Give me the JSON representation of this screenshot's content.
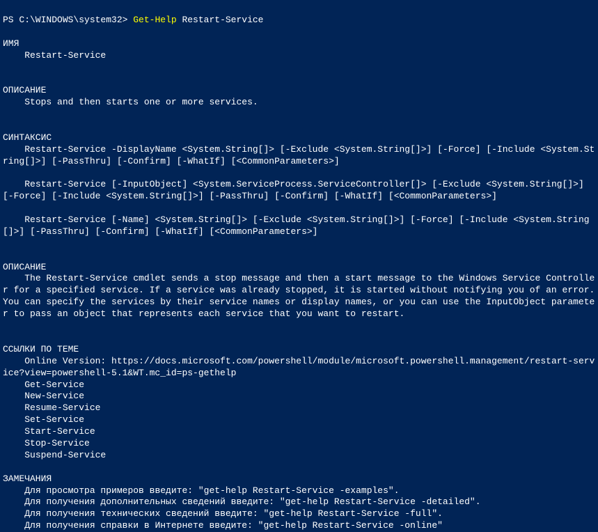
{
  "prompt": {
    "prefix": "PS C:\\WINDOWS\\system32> ",
    "command": "Get-Help",
    "argument": " Restart-Service"
  },
  "sections": {
    "name": {
      "header": "ИМЯ",
      "content": "Restart-Service"
    },
    "description1": {
      "header": "ОПИСАНИЕ",
      "content": "Stops and then starts one or more services."
    },
    "syntax": {
      "header": "СИНТАКСИС",
      "line1": "Restart-Service -DisplayName <System.String[]> [-Exclude <System.String[]>] [-Force] [-Include <System.String[]>] [-PassThru] [-Confirm] [-WhatIf] [<CommonParameters>]",
      "line2": "Restart-Service [-InputObject] <System.ServiceProcess.ServiceController[]> [-Exclude <System.String[]>] [-Force] [-Include <System.String[]>] [-PassThru] [-Confirm] [-WhatIf] [<CommonParameters>]",
      "line3": "Restart-Service [-Name] <System.String[]> [-Exclude <System.String[]>] [-Force] [-Include <System.String[]>] [-PassThru] [-Confirm] [-WhatIf] [<CommonParameters>]"
    },
    "description2": {
      "header": "ОПИСАНИЕ",
      "content": "The Restart-Service cmdlet sends a stop message and then a start message to the Windows Service Controller for a specified service. If a service was already stopped, it is started without notifying you of an error. You can specify the services by their service names or display names, or you can use the InputObject parameter to pass an object that represents each service that you want to restart."
    },
    "links": {
      "header": "ССЫЛКИ ПО ТЕМЕ",
      "items": [
        "Online Version: https://docs.microsoft.com/powershell/module/microsoft.powershell.management/restart-service?view=powershell-5.1&WT.mc_id=ps-gethelp",
        "Get-Service",
        "New-Service",
        "Resume-Service",
        "Set-Service",
        "Start-Service",
        "Stop-Service",
        "Suspend-Service"
      ]
    },
    "remarks": {
      "header": "ЗАМЕЧАНИЯ",
      "items": [
        "Для просмотра примеров введите: \"get-help Restart-Service -examples\".",
        "Для получения дополнительных сведений введите: \"get-help Restart-Service -detailed\".",
        "Для получения технических сведений введите: \"get-help Restart-Service -full\".",
        "Для получения справки в Интернете введите: \"get-help Restart-Service -online\""
      ]
    }
  }
}
